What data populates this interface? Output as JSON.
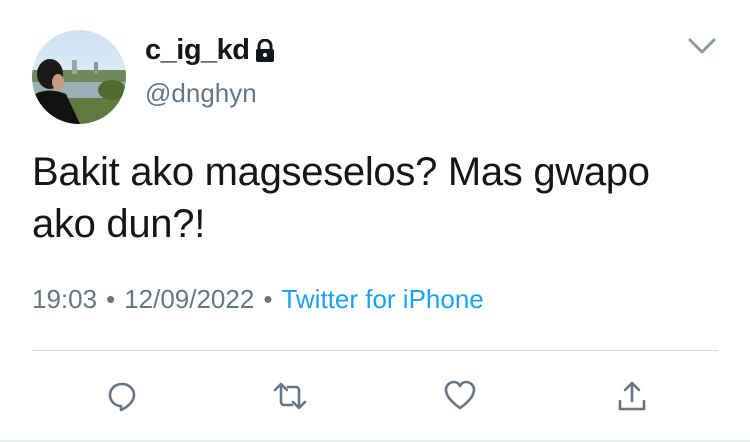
{
  "user": {
    "display_name": "c_ig_kd",
    "handle": "@dnghyn",
    "protected_icon": "lock-icon",
    "avatar_icon": "profile-photo"
  },
  "tweet": {
    "text": "Bakit ako magseselos? Mas gwapo ako dun?!",
    "time": "19:03",
    "date": "12/09/2022",
    "separator": "•",
    "source": "Twitter for iPhone"
  },
  "menu": {
    "icon": "chevron-down-icon"
  },
  "actions": [
    {
      "name": "reply",
      "icon": "reply-icon"
    },
    {
      "name": "retweet",
      "icon": "retweet-icon"
    },
    {
      "name": "like",
      "icon": "heart-icon"
    },
    {
      "name": "share",
      "icon": "share-icon"
    }
  ],
  "colors": {
    "text": "#14171a",
    "secondary": "#657786",
    "link": "#1da1f2",
    "divider": "#d6d9db"
  }
}
